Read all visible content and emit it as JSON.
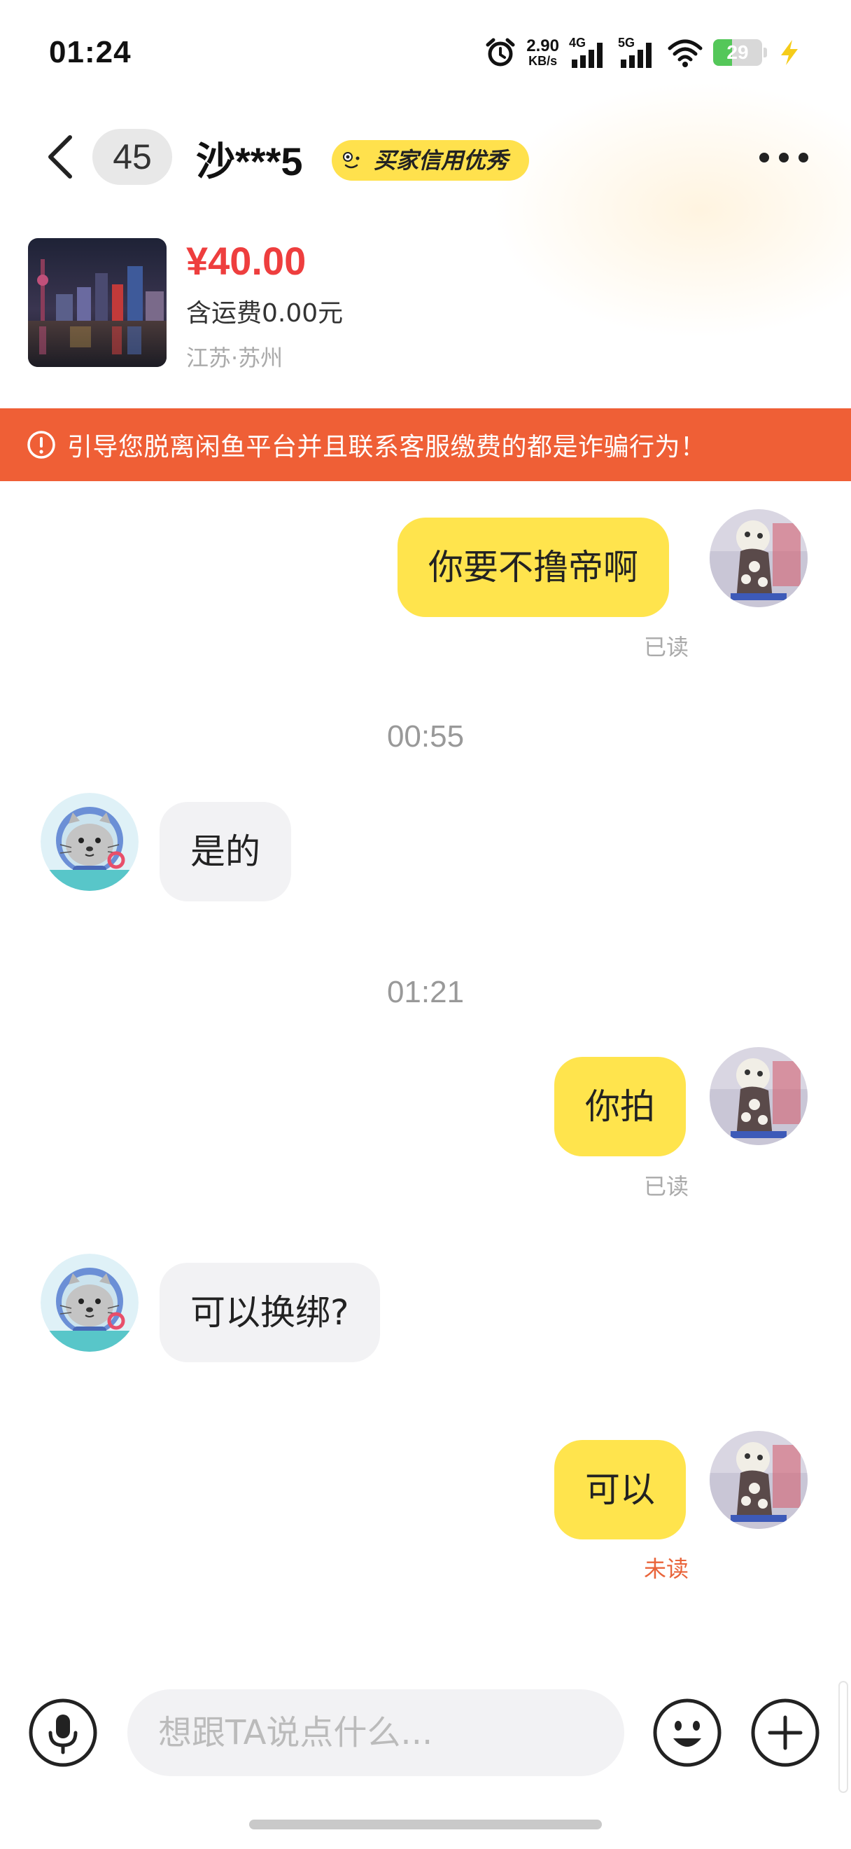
{
  "status_bar": {
    "time": "01:24",
    "net_speed_value": "2.90",
    "net_speed_unit": "KB/s",
    "network_1": "4G",
    "network_2": "5G",
    "battery": "29",
    "icons": [
      "alarm-icon",
      "signal-4g-icon",
      "signal-5g-icon",
      "wifi-icon",
      "battery-icon",
      "charging-icon"
    ]
  },
  "header": {
    "unread_count": "45",
    "nickname": "沙***5",
    "credit_badge": "买家信用优秀"
  },
  "product": {
    "price": "¥40.00",
    "shipping": "含运费0.00元",
    "location": "江苏·苏州"
  },
  "warning": {
    "text": "引导您脱离闲鱼平台并且联系客服缴费的都是诈骗行为！"
  },
  "messages": [
    {
      "side": "mine",
      "text": "你要不撸帝啊",
      "status": "已读"
    },
    {
      "divider": "00:55"
    },
    {
      "side": "theirs",
      "text": "是的"
    },
    {
      "divider": "01:21"
    },
    {
      "side": "mine",
      "text": "你拍",
      "status": "已读"
    },
    {
      "side": "theirs",
      "text": "可以换绑?"
    },
    {
      "side": "mine",
      "text": "可以",
      "status": "未读"
    }
  ],
  "input": {
    "placeholder": "想跟TA说点什么..."
  },
  "colors": {
    "accent_yellow": "#ffe44d",
    "price_red": "#ee3e3e",
    "warning_orange": "#ef5f36",
    "unread_orange": "#e9643a"
  }
}
